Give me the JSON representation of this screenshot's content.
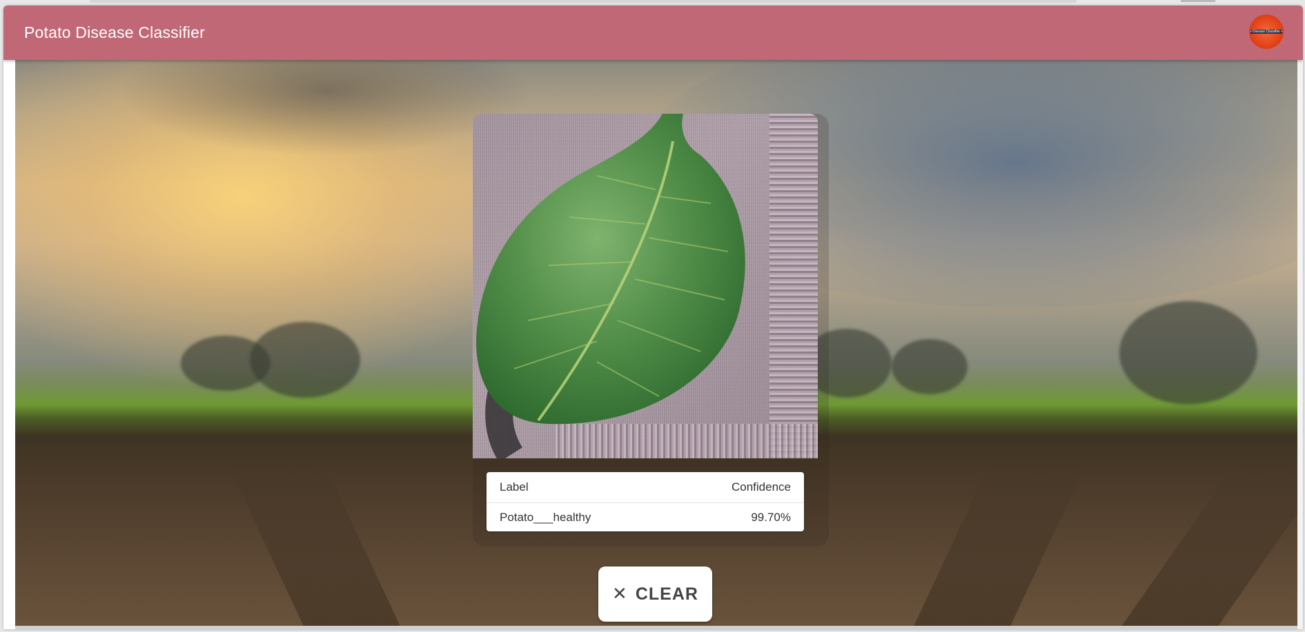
{
  "app": {
    "title": "Potato Disease Classifier",
    "logo_text": "• Disease Classifier •"
  },
  "results": {
    "header": {
      "label": "Label",
      "confidence": "Confidence"
    },
    "rows": [
      {
        "label": "Potato___healthy",
        "confidence": "99.70%"
      }
    ]
  },
  "actions": {
    "clear_label": "CLEAR",
    "clear_icon": "close-icon"
  },
  "colors": {
    "appbar": "#c06876",
    "accent_logo": "#e4461a"
  }
}
